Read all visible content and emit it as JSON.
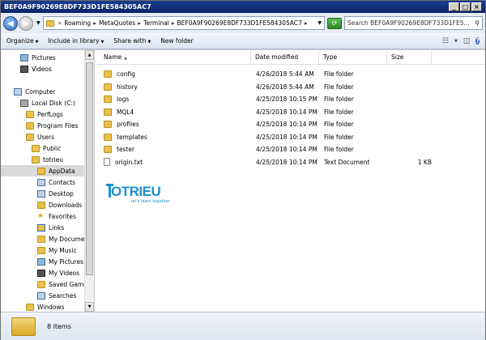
{
  "window": {
    "title": "BEF0A9F90269E8DF733D1FE584305AC7",
    "min": "_",
    "max": "□",
    "close": "×"
  },
  "address": {
    "crumbs": [
      "Roaming",
      "MetaQuotes",
      "Terminal",
      "BEF0A9F90269E8DF733D1FE584305AC7"
    ],
    "search_placeholder": "Search BEF0A9F90269E8DF733D1FE5..."
  },
  "toolbar": {
    "organize": "Organize",
    "include": "Include in library",
    "share": "Share with",
    "new_folder": "New folder"
  },
  "nav": [
    {
      "label": "Pictures",
      "icon": "pictures-icon"
    },
    {
      "label": "Videos",
      "icon": "videos-icon"
    },
    {
      "label": "Computer",
      "icon": "computer-icon"
    },
    {
      "label": "Local Disk (C:)",
      "icon": "disk-icon"
    },
    {
      "label": "PerfLogs",
      "icon": "folder-icon"
    },
    {
      "label": "Program Files",
      "icon": "folder-icon"
    },
    {
      "label": "Users",
      "icon": "folder-icon"
    },
    {
      "label": "Public",
      "icon": "folder-icon"
    },
    {
      "label": "totrieu",
      "icon": "folder-icon"
    },
    {
      "label": "AppData",
      "icon": "folder-icon"
    },
    {
      "label": "Contacts",
      "icon": "contacts-icon"
    },
    {
      "label": "Desktop",
      "icon": "desktop-icon"
    },
    {
      "label": "Downloads",
      "icon": "downloads-icon"
    },
    {
      "label": "Favorites",
      "icon": "favorites-icon"
    },
    {
      "label": "Links",
      "icon": "links-icon"
    },
    {
      "label": "My Documen",
      "icon": "folder-icon"
    },
    {
      "label": "My Music",
      "icon": "music-icon"
    },
    {
      "label": "My Pictures",
      "icon": "pictures-icon"
    },
    {
      "label": "My Videos",
      "icon": "videos-icon"
    },
    {
      "label": "Saved Game",
      "icon": "games-icon"
    },
    {
      "label": "Searches",
      "icon": "searches-icon"
    },
    {
      "label": "Windows",
      "icon": "folder-icon"
    }
  ],
  "columns": {
    "name": "Name",
    "date": "Date modified",
    "type": "Type",
    "size": "Size"
  },
  "files": [
    {
      "name": "config",
      "date": "4/26/2018 5:44 AM",
      "type": "File folder",
      "size": "",
      "kind": "folder"
    },
    {
      "name": "history",
      "date": "4/26/2018 5:44 AM",
      "type": "File folder",
      "size": "",
      "kind": "folder"
    },
    {
      "name": "logs",
      "date": "4/25/2018 10:15 PM",
      "type": "File folder",
      "size": "",
      "kind": "folder"
    },
    {
      "name": "MQL4",
      "date": "4/25/2018 10:14 PM",
      "type": "File folder",
      "size": "",
      "kind": "folder"
    },
    {
      "name": "profiles",
      "date": "4/25/2018 10:14 PM",
      "type": "File folder",
      "size": "",
      "kind": "folder"
    },
    {
      "name": "templates",
      "date": "4/25/2018 10:14 PM",
      "type": "File folder",
      "size": "",
      "kind": "folder"
    },
    {
      "name": "tester",
      "date": "4/25/2018 10:14 PM",
      "type": "File folder",
      "size": "",
      "kind": "folder"
    },
    {
      "name": "origin.txt",
      "date": "4/25/2018 10:14 PM",
      "type": "Text Document",
      "size": "1 KB",
      "kind": "doc"
    }
  ],
  "logo": {
    "main": "OTRIEU",
    "sub": "let's learn together",
    "color": "#1b8fd4"
  },
  "status": {
    "items": "8 items"
  }
}
